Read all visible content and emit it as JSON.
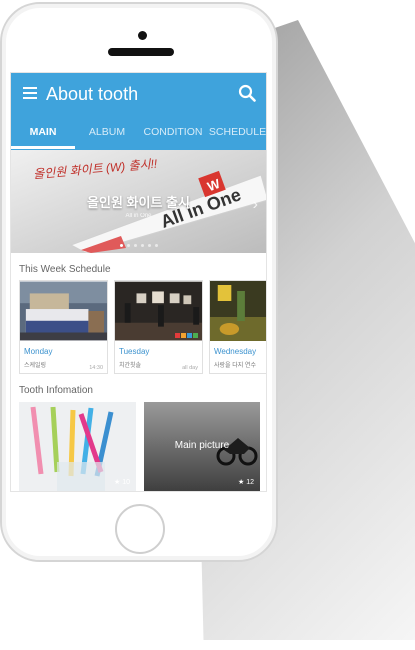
{
  "app": {
    "title": "About tooth"
  },
  "tabs": [
    {
      "label": "MAIN",
      "active": true
    },
    {
      "label": "ALBUM",
      "active": false
    },
    {
      "label": "CONDITION",
      "active": false
    },
    {
      "label": "SCHEDULE",
      "active": false
    }
  ],
  "banner": {
    "handwriting": "올인원 화이트 (W) 출시!!",
    "title": "올인원 화이트 출시",
    "subtitle": "All in One",
    "page_count": 6,
    "current_page": 0
  },
  "schedule": {
    "heading": "This Week Schedule",
    "cards": [
      {
        "day": "Monday",
        "desc": "스케일링",
        "time": "14:30"
      },
      {
        "day": "Tuesday",
        "desc": "치간칫솔",
        "time": "all day"
      },
      {
        "day": "Wednesday",
        "desc": "사랑을 다지 연수",
        "time": ""
      }
    ]
  },
  "info": {
    "heading": "Tooth Infomation",
    "cards": [
      {
        "caption": "",
        "count": "10"
      },
      {
        "caption": "Main picture",
        "count": "12"
      }
    ]
  },
  "colors": {
    "accent": "#3fa3dc",
    "day_text": "#3d93cf"
  },
  "icons": {
    "menu": "menu-icon",
    "search": "search-icon",
    "next": "chevron-right-icon",
    "star": "star-icon"
  }
}
